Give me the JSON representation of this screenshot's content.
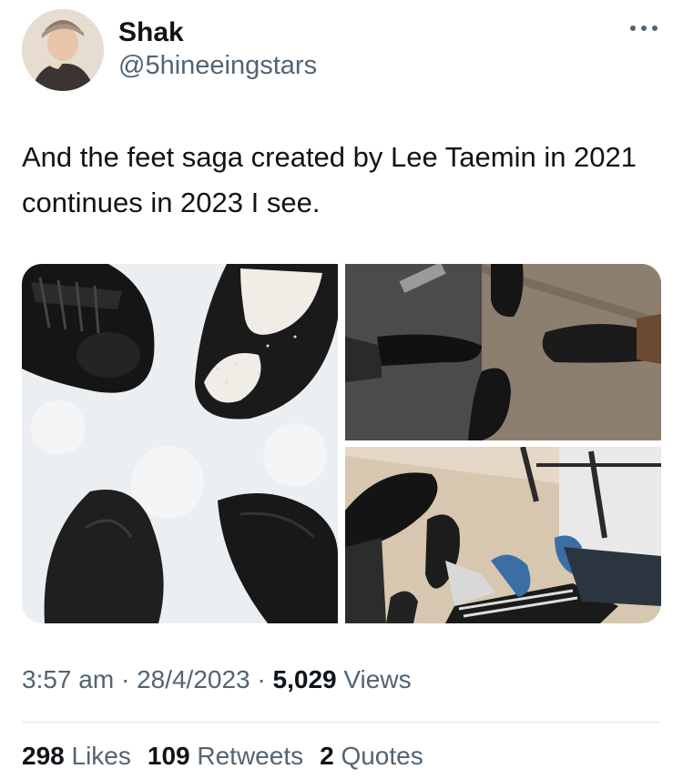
{
  "author": {
    "display_name": "Shak",
    "handle": "@5hineeingstars",
    "avatar_icon": "profile-photo"
  },
  "more_icon": "more-horizontal-icon",
  "tweet": {
    "text": "And the feet saga created by Lee Taemin in 2021 continues in 2023 I see."
  },
  "media": [
    {
      "name": "shoes-photo-overhead"
    },
    {
      "name": "feet-photo-floor"
    },
    {
      "name": "feet-photo-sneakers"
    }
  ],
  "meta": {
    "time": "3:57 am",
    "date": "28/4/2023",
    "views_count": "5,029",
    "views_label": "Views",
    "separator": "·"
  },
  "stats": {
    "likes_count": "298",
    "likes_label": "Likes",
    "retweets_count": "109",
    "retweets_label": "Retweets",
    "quotes_count": "2",
    "quotes_label": "Quotes"
  },
  "colors": {
    "text": "#0f1419",
    "secondary": "#536471",
    "divider": "#dfe3e7"
  }
}
